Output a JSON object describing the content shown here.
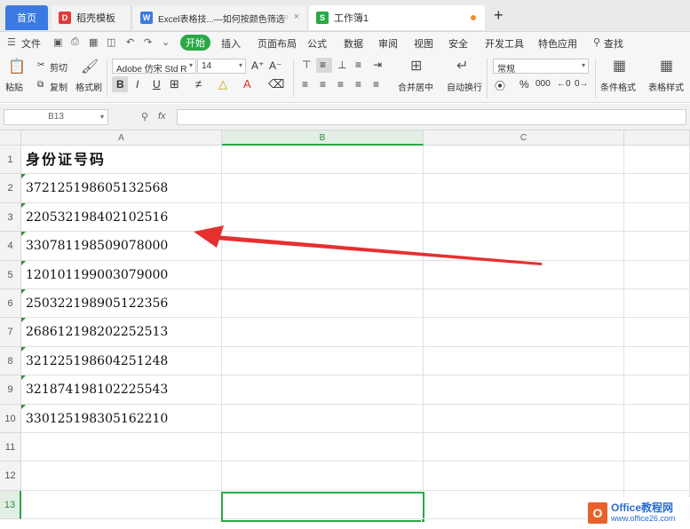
{
  "tabs": {
    "home": "首页",
    "t1": "稻壳模板",
    "t2": "Excel表格技...—如何按颜色筛选",
    "active": "工作簿1",
    "add": "+"
  },
  "menu": {
    "file": "文件",
    "start": "开始",
    "insert": "插入",
    "layout": "页面布局",
    "formula": "公式",
    "data": "数据",
    "review": "审阅",
    "view": "视图",
    "security": "安全",
    "devtools": "开发工具",
    "features": "特色应用",
    "search": "查找"
  },
  "ribbon": {
    "paste": "粘贴",
    "cut": "剪切",
    "copy": "复制",
    "format_painter": "格式刷",
    "font_name": "Adobe 仿宋 Std R",
    "font_size": "14",
    "bold": "B",
    "italic": "I",
    "underline": "U",
    "merge": "合并居中",
    "wrap": "自动换行",
    "number_format": "常规",
    "percent": "%",
    "cond_format": "条件格式",
    "table_style": "表格样式"
  },
  "formula_bar": {
    "name_box": "B13",
    "fx": "fx",
    "value": ""
  },
  "columns": [
    "A",
    "B",
    "C"
  ],
  "rows": [
    {
      "num": "1",
      "a": "身份证号码"
    },
    {
      "num": "2",
      "a": "372125198605132568"
    },
    {
      "num": "3",
      "a": "220532198402102516"
    },
    {
      "num": "4",
      "a": "330781198509078000"
    },
    {
      "num": "5",
      "a": "120101199003079000"
    },
    {
      "num": "6",
      "a": "250322198905122356"
    },
    {
      "num": "7",
      "a": "268612198202252513"
    },
    {
      "num": "8",
      "a": "321225198604251248"
    },
    {
      "num": "9",
      "a": "321874198102225543"
    },
    {
      "num": "10",
      "a": "330125198305162210"
    },
    {
      "num": "11",
      "a": ""
    },
    {
      "num": "12",
      "a": ""
    },
    {
      "num": "13",
      "a": ""
    }
  ],
  "annotation": {
    "color": "#e53030"
  },
  "watermark": {
    "logo": "O",
    "line1": "Office教程网",
    "line2": "www.office26.com"
  },
  "colors": {
    "accent": "#2aa845",
    "home_tab": "#3b7ae2",
    "arrow": "#e53030"
  }
}
